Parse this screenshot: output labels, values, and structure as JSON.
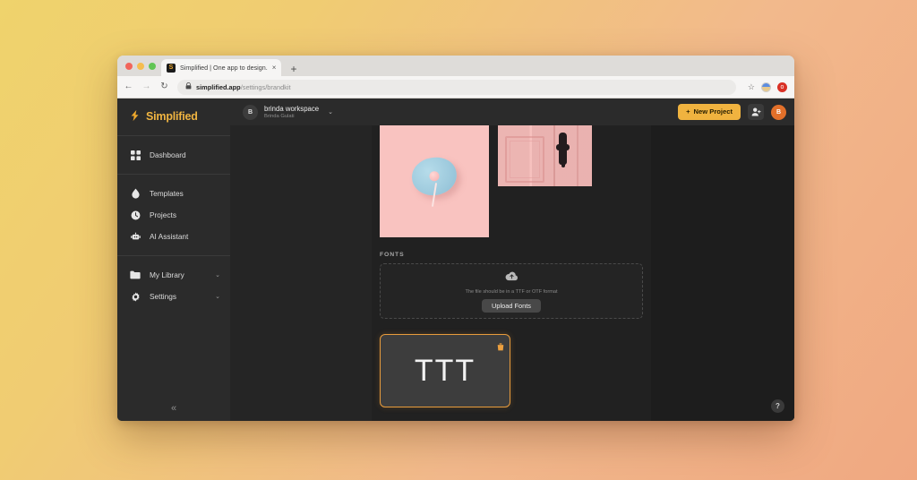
{
  "browser": {
    "tab": {
      "title": "Simplified | One app to design.",
      "favicon": "simplified-logo-icon",
      "close": "×"
    },
    "new_tab": "+",
    "nav": {
      "back": "←",
      "forward": "→",
      "reload": "↻"
    },
    "address": {
      "lock": "🔒",
      "domain": "simplified.app",
      "path": "/settings/brandkit"
    },
    "actions": {
      "bookmark": "☆",
      "extension_badge": "o"
    }
  },
  "sidebar": {
    "brand": {
      "mark": "⚡",
      "name": "Simplified"
    },
    "groups": [
      {
        "items": [
          {
            "label": "Dashboard",
            "icon": "grid-icon",
            "chevron": ""
          }
        ]
      },
      {
        "items": [
          {
            "label": "Templates",
            "icon": "drop-icon",
            "chevron": ""
          },
          {
            "label": "Projects",
            "icon": "clock-icon",
            "chevron": ""
          },
          {
            "label": "AI Assistant",
            "icon": "robot-icon",
            "chevron": ""
          }
        ]
      },
      {
        "items": [
          {
            "label": "My Library",
            "icon": "folder-icon",
            "chevron": "⌄"
          },
          {
            "label": "Settings",
            "icon": "gear-icon",
            "chevron": "⌄"
          }
        ]
      }
    ],
    "collapse": "«"
  },
  "topbar": {
    "workspace": {
      "avatar": "B",
      "name": "brinda workspace",
      "owner": "Brinda Gulati",
      "chevron": "⌄"
    },
    "new_project_label": "New Project",
    "new_project_plus": "+",
    "invite_icon": "add-user-icon",
    "user_avatar": "B",
    "accent_color": "#f0b33f"
  },
  "main": {
    "images": [
      {
        "name": "lollipop-on-blue-plate-pink-background"
      },
      {
        "name": "pink-door-with-dark-handle"
      }
    ],
    "fonts": {
      "section_title": "FONTS",
      "dropzone": {
        "icon": "cloud-upload-icon",
        "hint": "The file should be in a TTF or OTF format",
        "button_label": "Upload Fonts"
      },
      "cards": [
        {
          "preview_text": "TTT",
          "delete_icon": "trash-icon",
          "selected": true
        }
      ]
    },
    "help_button": "?"
  }
}
